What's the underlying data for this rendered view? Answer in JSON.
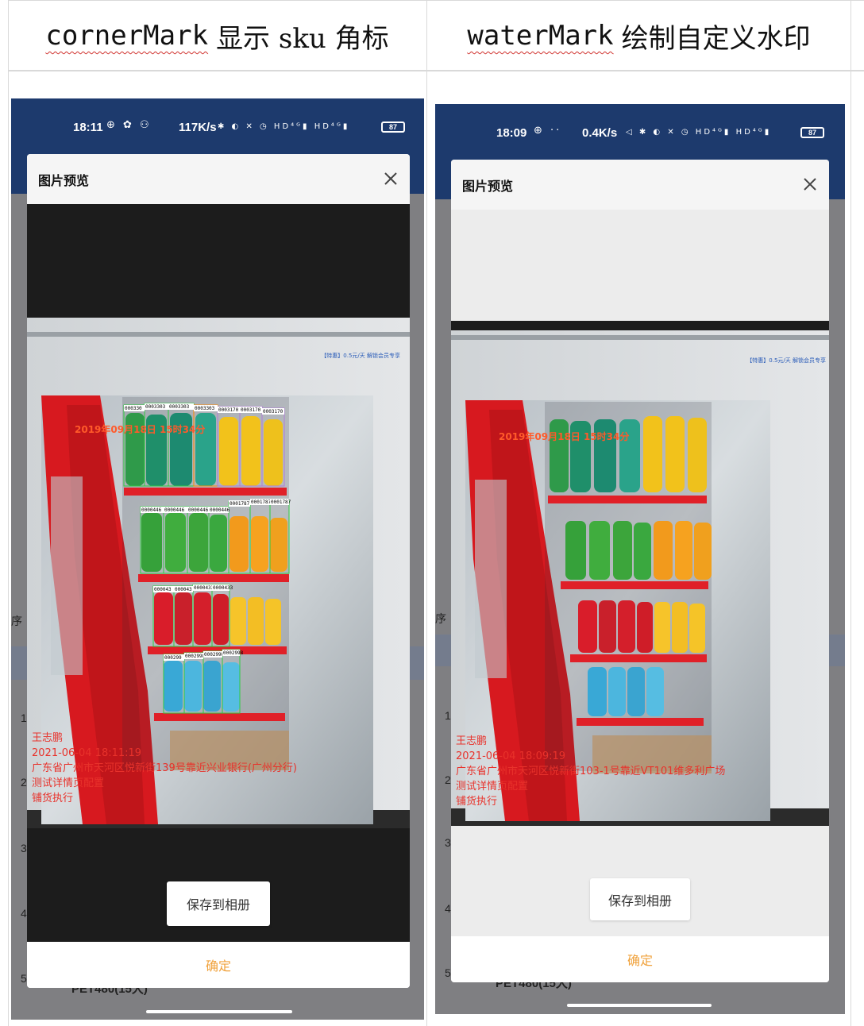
{
  "table": {
    "left_header": {
      "code": "cornerMark",
      "text": "显示 sku 角标"
    },
    "right_header": {
      "code": "waterMark",
      "text": "绘制自定义水印"
    }
  },
  "left_phone": {
    "status_bar": {
      "time": "18:11",
      "speed": "117K/s",
      "icons": "⊕ ✿ ⚇",
      "right_icons": "✱ ◐ ✕ ◷ HD⁴ᴳ▮ HD⁴ᴳ▮",
      "battery": "87"
    },
    "dialog": {
      "title": "图片预览",
      "save_label": "保存到相册",
      "confirm_label": "确定"
    },
    "photo": {
      "date_stamp": "2019年09月18日 15时34分",
      "price_tag": "【特惠】0.5元/天  解锁会员专享",
      "watermark": {
        "name": "王志鹏",
        "datetime": "2021-06-04 18:11:19",
        "address": "广东省广州市天河区悦新街139号靠近兴业银行(广州分行)",
        "line4": "测试详情页配置",
        "line5": "铺货执行"
      },
      "sku_rows": [
        [
          "000330",
          "0003303",
          "0003303",
          "0003303",
          "0003170",
          "0003170",
          "0003170"
        ],
        [
          "0000446",
          "0000446",
          "0000446",
          "0000446",
          "0001787",
          "0001787",
          "0001787"
        ],
        [
          "000043",
          "000043",
          "0000433",
          "0000433"
        ],
        [
          "000299",
          "0002998",
          "0002998",
          "0002998"
        ]
      ]
    },
    "background": {
      "header_cell": "序",
      "row_numbers": [
        "1",
        "2",
        "3",
        "4",
        "5"
      ],
      "bottom_text": "PET480(15大)"
    }
  },
  "right_phone": {
    "status_bar": {
      "time": "18:09",
      "speed": "0.4K/s",
      "icons": "⊕ ··",
      "right_icons": "◁ ✱ ◐ ✕ ◷ HD⁴ᴳ▮ HD⁴ᴳ▮",
      "battery": "87"
    },
    "dialog": {
      "title": "图片预览",
      "save_label": "保存到相册",
      "confirm_label": "确定"
    },
    "photo": {
      "date_stamp": "2019年09月18日 15时34分",
      "price_tag": "【特惠】0.5元/天  解锁会员专享",
      "watermark": {
        "name": "王志鹏",
        "datetime": "2021-06-04 18:09:19",
        "address": "广东省广州市天河区悦新街103-1号靠近VT101维多利广场",
        "line4": "测试详情页配置",
        "line5": "铺货执行"
      }
    },
    "background": {
      "header_cell": "序",
      "row_numbers": [
        "1",
        "2",
        "3",
        "4",
        "5"
      ],
      "bottom_text": "PET480(15大)"
    }
  },
  "colors": {
    "status_bar": "#1d3a6d",
    "confirm_text": "#f0a23c",
    "watermark_red": "#e8322b",
    "date_stamp": "#ff5a2a",
    "fridge_red": "#d7191f"
  }
}
